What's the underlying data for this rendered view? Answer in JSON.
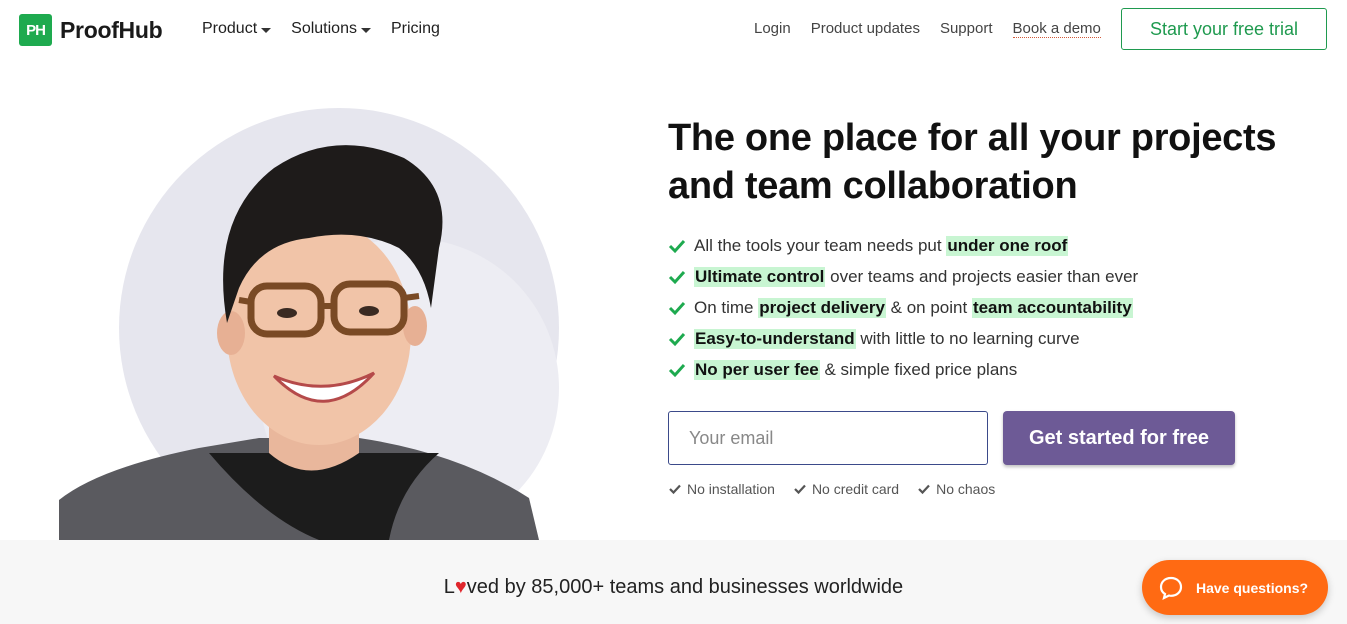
{
  "brand": {
    "logo_mark": "PH",
    "name": "ProofHub",
    "accent": "#1eaa4f"
  },
  "nav": {
    "left": [
      "Product",
      "Solutions",
      "Pricing"
    ],
    "right": [
      "Login",
      "Product updates",
      "Support",
      "Book a demo"
    ],
    "trial_button": "Start your free trial"
  },
  "hero": {
    "headline": "The one place for all your projects and team collaboration",
    "features": [
      [
        {
          "t": "All the tools your team needs put ",
          "h": false
        },
        {
          "t": "under one roof",
          "h": true
        }
      ],
      [
        {
          "t": "Ultimate control",
          "h": true
        },
        {
          "t": " over teams and projects easier than ever",
          "h": false
        }
      ],
      [
        {
          "t": "On time ",
          "h": false
        },
        {
          "t": "project delivery",
          "h": true
        },
        {
          "t": " & on point ",
          "h": false
        },
        {
          "t": "team accountability",
          "h": true
        }
      ],
      [
        {
          "t": "Easy-to-understand",
          "h": true
        },
        {
          "t": " with little to no learning curve",
          "h": false
        }
      ],
      [
        {
          "t": "No per user fee",
          "h": true
        },
        {
          "t": " & simple fixed price plans",
          "h": false
        }
      ]
    ],
    "email_placeholder": "Your email",
    "cta": "Get started for free",
    "notes": [
      "No installation",
      "No credit card",
      "No chaos"
    ],
    "cta_color": "#6d5a96",
    "highlight_color": "#c8f5d2"
  },
  "social_proof": {
    "prefix": "L",
    "heart": "♥",
    "suffix": "ved by 85,000+ teams and businesses worldwide"
  },
  "chat": {
    "label": "Have questions?",
    "color": "#ff6a13"
  }
}
